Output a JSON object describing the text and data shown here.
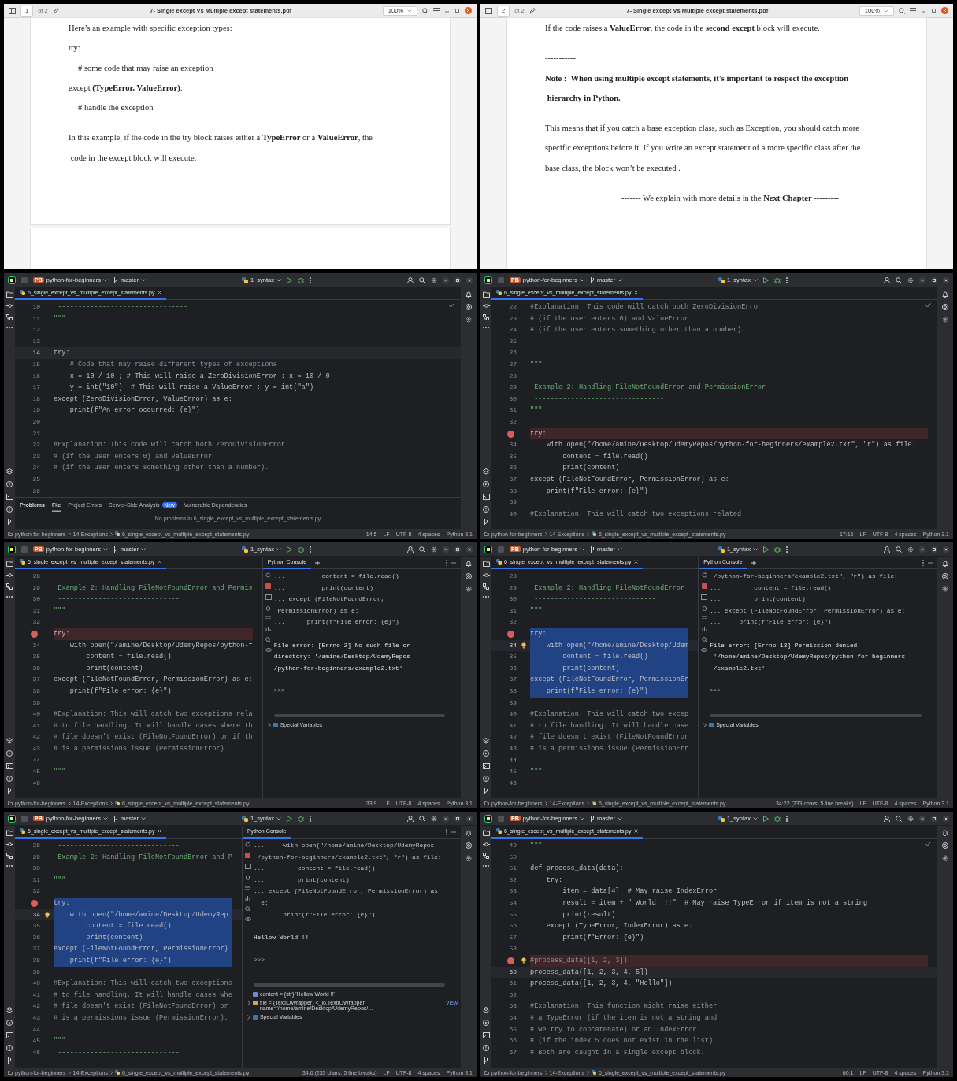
{
  "panels": [
    {
      "kind": "pdf",
      "toolbar": {
        "page": "1",
        "page_count": "of 2",
        "title": "7- Single except  Vs Multiple except statements.pdf",
        "zoom": "100%"
      },
      "next_page_visible": true,
      "blocks": [
        {
          "lines": [
            {
              "kind": "text",
              "text": "Here’s an example with specific exception types:"
            },
            {
              "kind": "text",
              "text": "try:"
            },
            {
              "kind": "code",
              "text": "# some code that may raise an exception"
            },
            {
              "kind": "text",
              "text": "except **(TypeError, ValueError)**:"
            },
            {
              "kind": "code",
              "text": "# handle the exception"
            }
          ]
        },
        {
          "lines": [
            {
              "kind": "text",
              "text": "In this example, if the code in the try block raises either a **TypeError** or a **ValueError**, the"
            },
            {
              "kind": "text",
              "text": " code in the except block will execute."
            }
          ]
        }
      ]
    },
    {
      "kind": "pdf",
      "toolbar": {
        "page": "2",
        "page_count": "of 2",
        "title": "7- Single except  Vs Multiple except statements.pdf",
        "zoom": "100%"
      },
      "next_page_visible": false,
      "blocks": [
        {
          "lines": [
            {
              "kind": "text",
              "text": "If the code raises a **ValueError**, the code in the **second except** block will execute."
            }
          ]
        },
        {
          "lines": [
            {
              "kind": "text",
              "text": "-----------"
            },
            {
              "kind": "bold",
              "text": "Note :  When using multiple except statements, it's important to respect the exception"
            },
            {
              "kind": "bold",
              "text": " hierarchy in Python."
            }
          ]
        },
        {
          "lines": [
            {
              "kind": "text",
              "text": "This means that if you catch a base exception class, such as Exception, you should catch more"
            },
            {
              "kind": "text",
              "text": "specific exceptions before it. If you write an except statement of a more specific class after the"
            },
            {
              "kind": "text",
              "text": "base class, the block won’t be executed ."
            }
          ]
        },
        {
          "lines": [
            {
              "kind": "center",
              "text": "------- We explain with more details in the **Next Chapter** ---------"
            }
          ]
        }
      ]
    },
    {
      "kind": "ide",
      "header": {
        "badge": "PB",
        "project": "python-for-beginners",
        "branch": "master",
        "run_config": "1_syntax"
      },
      "tabs": [
        {
          "label": "6_single_except_vs_multiple_except_statements.py",
          "selected": true
        }
      ],
      "inspection_ok": true,
      "lines": [
        {
          "n": "10",
          "text": " --------------------------------",
          "kind": "doc",
          "breakpoint": false,
          "selected": false,
          "current": false,
          "hint": false
        },
        {
          "n": "11",
          "text": "\"\"\"",
          "kind": "doc",
          "breakpoint": false,
          "selected": false,
          "current": false,
          "hint": false
        },
        {
          "n": "12",
          "kind": "blank",
          "breakpoint": false,
          "selected": false,
          "current": false,
          "hint": false
        },
        {
          "n": "13",
          "kind": "blank",
          "breakpoint": false,
          "selected": false,
          "current": false,
          "hint": false
        },
        {
          "n": "14",
          "text": "try:",
          "kind": "code",
          "breakpoint": false,
          "selected": false,
          "current": true,
          "hint": false
        },
        {
          "n": "15",
          "text": "    # Code that may raise different types of exceptions",
          "kind": "comment",
          "breakpoint": false,
          "selected": false,
          "current": false,
          "hint": false
        },
        {
          "n": "16",
          "text": "    x = 10 / 10 ; # This will raise a ZeroDivisionError : x = 10 / 0",
          "kind": "code",
          "breakpoint": false,
          "selected": false,
          "current": false,
          "hint": false
        },
        {
          "n": "17",
          "text": "    y = int(\"10\")  # This will raise a ValueError : y = int(\"a\")",
          "kind": "code",
          "breakpoint": false,
          "selected": false,
          "current": false,
          "hint": false
        },
        {
          "n": "18",
          "text": "except (ZeroDivisionError, ValueError) as e:",
          "kind": "code",
          "breakpoint": false,
          "selected": false,
          "current": false,
          "hint": false
        },
        {
          "n": "19",
          "text": "    print(f\"An error occurred: {e}\")",
          "kind": "code",
          "breakpoint": false,
          "selected": false,
          "current": false,
          "hint": false
        },
        {
          "n": "20",
          "kind": "blank",
          "breakpoint": false,
          "selected": false,
          "current": false,
          "hint": false
        },
        {
          "n": "21",
          "kind": "blank",
          "breakpoint": false,
          "selected": false,
          "current": false,
          "hint": false
        },
        {
          "n": "22",
          "text": "#Explanation: This code will catch both ZeroDivisionError",
          "kind": "comment",
          "breakpoint": false,
          "selected": false,
          "current": false,
          "hint": false
        },
        {
          "n": "23",
          "text": "# (if the user enters 0) and ValueError",
          "kind": "comment",
          "breakpoint": false,
          "selected": false,
          "current": false,
          "hint": false
        },
        {
          "n": "24",
          "text": "# (if the user enters something other than a number).",
          "kind": "comment",
          "breakpoint": false,
          "selected": false,
          "current": false,
          "hint": false
        },
        {
          "n": "25",
          "kind": "blank",
          "breakpoint": false,
          "selected": false,
          "current": false,
          "hint": false
        },
        {
          "n": "26",
          "kind": "blank",
          "breakpoint": false,
          "selected": false,
          "current": false,
          "hint": false
        }
      ],
      "problems": {
        "title": "Problems",
        "tabs": [
          {
            "label": "File",
            "selected": true
          },
          {
            "label": "Project Errors",
            "selected": false
          },
          {
            "label": "Server-Side Analysis",
            "badge": "New",
            "selected": false
          },
          {
            "label": "Vulnerable Dependencies",
            "selected": false
          }
        ],
        "message": "No problems in 6_single_except_vs_multiple_except_statements.py"
      },
      "status": {
        "crumbs": [
          "python-for-beginners",
          "14-Exceptions",
          "6_single_except_vs_multiple_except_statements.py"
        ],
        "position": "14:5",
        "line_separator": "LF",
        "encoding": "UTF-8",
        "indent": "4 spaces",
        "interpreter": "Python 3.1"
      }
    },
    {
      "kind": "ide",
      "header": {
        "badge": "PB",
        "project": "python-for-beginners",
        "branch": "master",
        "run_config": "1_syntax"
      },
      "tabs": [
        {
          "label": "6_single_except_vs_multiple_except_statements.py",
          "selected": true
        }
      ],
      "inspection_ok": true,
      "lines": [
        {
          "n": "22",
          "text": "#Explanation: This code will catch both ZeroDivisionError",
          "kind": "comment",
          "breakpoint": false,
          "selected": false,
          "current": false,
          "hint": false
        },
        {
          "n": "23",
          "text": "# (if the user enters 0) and ValueError",
          "kind": "comment",
          "breakpoint": false,
          "selected": false,
          "current": false,
          "hint": false
        },
        {
          "n": "24",
          "text": "# (if the user enters something other than a number).",
          "kind": "comment",
          "breakpoint": false,
          "selected": false,
          "current": false,
          "hint": false
        },
        {
          "n": "25",
          "kind": "blank",
          "breakpoint": false,
          "selected": false,
          "current": false,
          "hint": false
        },
        {
          "n": "26",
          "kind": "blank",
          "breakpoint": false,
          "selected": false,
          "current": false,
          "hint": false
        },
        {
          "n": "27",
          "text": "\"\"\"",
          "kind": "doc",
          "breakpoint": false,
          "selected": false,
          "current": false,
          "hint": false
        },
        {
          "n": "28",
          "text": " --------------------------------",
          "kind": "doc",
          "breakpoint": false,
          "selected": false,
          "current": false,
          "hint": false
        },
        {
          "n": "29",
          "text": " Example 2: Handling FileNotFoundError and PermissionError",
          "kind": "doc",
          "breakpoint": false,
          "selected": false,
          "current": false,
          "hint": false
        },
        {
          "n": "30",
          "text": " --------------------------------",
          "kind": "doc",
          "breakpoint": false,
          "selected": false,
          "current": false,
          "hint": false
        },
        {
          "n": "31",
          "text": "\"\"\"",
          "kind": "doc",
          "breakpoint": false,
          "selected": false,
          "current": false,
          "hint": false
        },
        {
          "n": "32",
          "kind": "blank",
          "breakpoint": false,
          "selected": false,
          "current": false,
          "hint": false
        },
        {
          "text": "try:",
          "kind": "code",
          "breakpoint": true,
          "selected": false,
          "current": false,
          "hint": false
        },
        {
          "n": "34",
          "text": "    with open(\"/home/amine/Desktop/UdemyRepos/python-for-beginners/example2.txt\", \"r\") as file:",
          "kind": "code",
          "breakpoint": false,
          "selected": false,
          "current": false,
          "hint": false
        },
        {
          "n": "35",
          "text": "        content = file.read()",
          "kind": "code",
          "breakpoint": false,
          "selected": false,
          "current": false,
          "hint": false
        },
        {
          "n": "36",
          "text": "        print(content)",
          "kind": "code",
          "breakpoint": false,
          "selected": false,
          "current": false,
          "hint": false
        },
        {
          "n": "37",
          "text": "except (FileNotFoundError, PermissionError) as e:",
          "kind": "code",
          "breakpoint": false,
          "selected": false,
          "current": false,
          "hint": false
        },
        {
          "n": "38",
          "text": "    print(f\"File error: {e}\")",
          "kind": "code",
          "breakpoint": false,
          "selected": false,
          "current": false,
          "hint": false
        },
        {
          "n": "39",
          "kind": "blank",
          "breakpoint": false,
          "selected": false,
          "current": false,
          "hint": false
        },
        {
          "n": "40",
          "text": "#Explanation: This will catch two exceptions related",
          "kind": "comment",
          "breakpoint": false,
          "selected": false,
          "current": false,
          "hint": false
        }
      ],
      "status": {
        "crumbs": [
          "python-for-beginners",
          "14-Exceptions",
          "6_single_except_vs_multiple_except_statements.py"
        ],
        "position": "17:16",
        "line_separator": "LF",
        "encoding": "UTF-8",
        "indent": "4 spaces",
        "interpreter": "Python 3.1"
      }
    },
    {
      "kind": "ide",
      "header": {
        "badge": "PB",
        "project": "python-for-beginners",
        "branch": "master",
        "run_config": "1_syntax"
      },
      "tabs": [
        {
          "label": "6_single_except_vs_multiple_except_statements.py",
          "selected": true
        }
      ],
      "inspection_ok": false,
      "lines": [
        {
          "n": "28",
          "text": " ------------------------------",
          "kind": "doc",
          "breakpoint": false,
          "selected": false,
          "current": false,
          "hint": false
        },
        {
          "n": "29",
          "text": " Example 2: Handling FileNotFoundError and Permis",
          "kind": "doc",
          "breakpoint": false,
          "selected": false,
          "current": false,
          "hint": false
        },
        {
          "n": "30",
          "text": " ------------------------------",
          "kind": "doc",
          "breakpoint": false,
          "selected": false,
          "current": false,
          "hint": false
        },
        {
          "n": "31",
          "text": "\"\"\"",
          "kind": "doc",
          "breakpoint": false,
          "selected": false,
          "current": false,
          "hint": false
        },
        {
          "n": "32",
          "kind": "blank",
          "breakpoint": false,
          "selected": false,
          "current": false,
          "hint": false
        },
        {
          "text": "try:",
          "kind": "code",
          "breakpoint": true,
          "selected": false,
          "current": false,
          "hint": false
        },
        {
          "n": "34",
          "text": "    with open(\"/amine/Desktop/UdemyRepos/python-f",
          "kind": "code",
          "breakpoint": false,
          "selected": false,
          "current": false,
          "hint": false
        },
        {
          "n": "35",
          "text": "        content = file.read()",
          "kind": "code",
          "breakpoint": false,
          "selected": false,
          "current": false,
          "hint": false
        },
        {
          "n": "36",
          "text": "        print(content)",
          "kind": "code",
          "breakpoint": false,
          "selected": false,
          "current": false,
          "hint": false
        },
        {
          "n": "37",
          "text": "except (FileNotFoundError, PermissionError) as e:",
          "kind": "code",
          "breakpoint": false,
          "selected": false,
          "current": false,
          "hint": false
        },
        {
          "n": "38",
          "text": "    print(f\"File error: {e}\")",
          "kind": "code",
          "breakpoint": false,
          "selected": false,
          "current": false,
          "hint": false
        },
        {
          "n": "39",
          "kind": "blank",
          "breakpoint": false,
          "selected": false,
          "current": false,
          "hint": false
        },
        {
          "n": "40",
          "text": "#Explanation: This will catch two exceptions rela",
          "kind": "comment",
          "breakpoint": false,
          "selected": false,
          "current": false,
          "hint": false
        },
        {
          "n": "41",
          "text": "# to file handling. It will handle cases where th",
          "kind": "comment",
          "breakpoint": false,
          "selected": false,
          "current": false,
          "hint": false
        },
        {
          "n": "42",
          "text": "# file doesn't exist (FileNotFoundError) or if th",
          "kind": "comment",
          "breakpoint": false,
          "selected": false,
          "current": false,
          "hint": false
        },
        {
          "n": "43",
          "text": "# is a permissions issue (PermissionError).",
          "kind": "comment",
          "breakpoint": false,
          "selected": false,
          "current": false,
          "hint": false
        },
        {
          "n": "44",
          "kind": "blank",
          "breakpoint": false,
          "selected": false,
          "current": false,
          "hint": false
        },
        {
          "n": "45",
          "text": "\"\"\"",
          "kind": "doc",
          "breakpoint": false,
          "selected": false,
          "current": false,
          "hint": false
        },
        {
          "n": "46",
          "text": " ------------------------------",
          "kind": "doc",
          "breakpoint": false,
          "selected": false,
          "current": false,
          "hint": false
        }
      ],
      "console": {
        "title": "Python Console",
        "add_button": true,
        "lines": [
          {
            "text": "...          content = file.read()",
            "kind": "input"
          },
          {
            "text": "...          print(content)",
            "kind": "input"
          },
          {
            "text": "... except (FileNotFoundError,",
            "kind": "input"
          },
          {
            "text": " PermissionError) as e:",
            "kind": "input"
          },
          {
            "text": "...      print(f\"File error: {e}\")",
            "kind": "input"
          },
          {
            "text": "...",
            "kind": "input"
          },
          {
            "text": "File error: [Errno 2] No such file or",
            "kind": "output"
          },
          {
            "text": "directory: '/amine/Desktop/UdemyRepos",
            "kind": "output"
          },
          {
            "text": "/python-for-beginners/example2.txt'",
            "kind": "output"
          },
          {
            "text": ">>>",
            "kind": "prompt"
          }
        ],
        "variables": [
          {
            "kind": "group",
            "text": "Special Variables"
          }
        ]
      },
      "status": {
        "crumbs": [
          "python-for-beginners",
          "14-Exceptions",
          "6_single_except_vs_multiple_except_statements.py"
        ],
        "position": "33:9",
        "line_separator": "LF",
        "encoding": "UTF-8",
        "indent": "4 spaces",
        "interpreter": "Python 3.1"
      }
    },
    {
      "kind": "ide",
      "header": {
        "badge": "PB",
        "project": "python-for-beginners",
        "branch": "master",
        "run_config": "1_syntax"
      },
      "tabs": [
        {
          "label": "6_single_except_vs_multiple_except_statements.py",
          "selected": true
        }
      ],
      "inspection_ok": false,
      "lines": [
        {
          "n": "28",
          "text": " ------------------------------",
          "kind": "doc",
          "breakpoint": false,
          "selected": false,
          "current": false,
          "hint": false
        },
        {
          "n": "29",
          "text": " Example 2: Handling FileNotFoundError",
          "kind": "doc",
          "breakpoint": false,
          "selected": false,
          "current": false,
          "hint": false
        },
        {
          "n": "30",
          "text": " ------------------------------",
          "kind": "doc",
          "breakpoint": false,
          "selected": false,
          "current": false,
          "hint": false
        },
        {
          "n": "31",
          "text": "\"\"\"",
          "kind": "doc",
          "breakpoint": false,
          "selected": false,
          "current": false,
          "hint": false
        },
        {
          "n": "32",
          "kind": "blank",
          "breakpoint": false,
          "selected": false,
          "current": false,
          "hint": false
        },
        {
          "text": "try:",
          "kind": "code",
          "breakpoint": true,
          "selected": true,
          "current": false,
          "hint": false
        },
        {
          "n": "34",
          "text": "    with open(\"/home/amine/Desktop/Udem",
          "kind": "code",
          "breakpoint": false,
          "selected": true,
          "current": true,
          "hint": true
        },
        {
          "n": "35",
          "text": "        content = file.read()",
          "kind": "code",
          "breakpoint": false,
          "selected": true,
          "current": false,
          "hint": false
        },
        {
          "n": "36",
          "text": "        print(content)",
          "kind": "code",
          "breakpoint": false,
          "selected": true,
          "current": false,
          "hint": false
        },
        {
          "n": "37",
          "text": "except (FileNotFoundError, PermissionEr",
          "kind": "code",
          "breakpoint": false,
          "selected": true,
          "current": false,
          "hint": false
        },
        {
          "n": "38",
          "text": "    print(f\"File error: {e}\")",
          "kind": "code",
          "breakpoint": false,
          "selected": true,
          "current": false,
          "hint": false
        },
        {
          "n": "39",
          "kind": "blank",
          "breakpoint": false,
          "selected": false,
          "current": false,
          "hint": false
        },
        {
          "n": "40",
          "text": "#Explanation: This will catch two excep",
          "kind": "comment",
          "breakpoint": false,
          "selected": false,
          "current": false,
          "hint": false
        },
        {
          "n": "41",
          "text": "# to file handling. It will handle case",
          "kind": "comment",
          "breakpoint": false,
          "selected": false,
          "current": false,
          "hint": false
        },
        {
          "n": "42",
          "text": "# file doesn't exist (FileNotFoundError",
          "kind": "comment",
          "breakpoint": false,
          "selected": false,
          "current": false,
          "hint": false
        },
        {
          "n": "43",
          "text": "# is a permissions issue (PermissionErr",
          "kind": "comment",
          "breakpoint": false,
          "selected": false,
          "current": false,
          "hint": false
        },
        {
          "n": "44",
          "kind": "blank",
          "breakpoint": false,
          "selected": false,
          "current": false,
          "hint": false
        },
        {
          "n": "45",
          "text": "\"\"\"",
          "kind": "doc",
          "breakpoint": false,
          "selected": false,
          "current": false,
          "hint": false
        },
        {
          "n": "46",
          "text": " ------------------------------",
          "kind": "doc",
          "breakpoint": false,
          "selected": false,
          "current": false,
          "hint": false
        }
      ],
      "console": {
        "title": "Python Console",
        "add_button": true,
        "lines": [
          {
            "text": " /python-for-beginners/example2.txt\", \"r\") as file:",
            "kind": "input"
          },
          {
            "text": "...         content = file.read()",
            "kind": "input"
          },
          {
            "text": "...         print(content)",
            "kind": "input"
          },
          {
            "text": "... except (FileNotFoundError, PermissionError) as e:",
            "kind": "input"
          },
          {
            "text": "...     print(f\"File error: {e}\")",
            "kind": "input"
          },
          {
            "text": "...",
            "kind": "input"
          },
          {
            "text": "File error: [Errno 13] Permission denied:",
            "kind": "output"
          },
          {
            "text": " '/home/amine/Desktop/UdemyRepos/python-for-beginners",
            "kind": "output"
          },
          {
            "text": " /example2.txt'",
            "kind": "output"
          },
          {
            "text": ">>>",
            "kind": "prompt"
          }
        ],
        "variables": [
          {
            "kind": "group",
            "text": "Special Variables"
          }
        ]
      },
      "status": {
        "crumbs": [
          "python-for-beginners",
          "14-Exceptions",
          "6_single_except_vs_multiple_except_statements.py"
        ],
        "position": "34:22 (233 chars, 5 line breaks)",
        "line_separator": "LF",
        "encoding": "UTF-8",
        "indent": "4 spaces",
        "interpreter": "Python 3.1"
      }
    },
    {
      "kind": "ide",
      "header": {
        "badge": "PB",
        "project": "python-for-beginners",
        "branch": "master",
        "run_config": "1_syntax"
      },
      "tabs": [
        {
          "label": "6_single_except_vs_multiple_except_statements.py",
          "selected": true
        }
      ],
      "inspection_ok": false,
      "lines": [
        {
          "n": "28",
          "text": " ------------------------------",
          "kind": "doc",
          "breakpoint": false,
          "selected": false,
          "current": false,
          "hint": false
        },
        {
          "n": "29",
          "text": " Example 2: Handling FileNotFoundError and P",
          "kind": "doc",
          "breakpoint": false,
          "selected": false,
          "current": false,
          "hint": false
        },
        {
          "n": "30",
          "text": " ------------------------------",
          "kind": "doc",
          "breakpoint": false,
          "selected": false,
          "current": false,
          "hint": false
        },
        {
          "n": "31",
          "text": "\"\"\"",
          "kind": "doc",
          "breakpoint": false,
          "selected": false,
          "current": false,
          "hint": false
        },
        {
          "n": "32",
          "kind": "blank",
          "breakpoint": false,
          "selected": false,
          "current": false,
          "hint": false
        },
        {
          "text": "try:",
          "kind": "code",
          "breakpoint": true,
          "selected": true,
          "current": false,
          "hint": false
        },
        {
          "n": "34",
          "text": "    with open(\"/home/amine/Desktop/UdemyRep",
          "kind": "code",
          "breakpoint": false,
          "selected": true,
          "current": true,
          "hint": true
        },
        {
          "n": "35",
          "text": "        content = file.read()",
          "kind": "code",
          "breakpoint": false,
          "selected": true,
          "current": false,
          "hint": false
        },
        {
          "n": "36",
          "text": "        print(content)",
          "kind": "code",
          "breakpoint": false,
          "selected": true,
          "current": false,
          "hint": false
        },
        {
          "n": "37",
          "text": "except (FileNotFoundError, PermissionError)",
          "kind": "code",
          "breakpoint": false,
          "selected": true,
          "current": false,
          "hint": false
        },
        {
          "n": "38",
          "text": "    print(f\"File error: {e}\")",
          "kind": "code",
          "breakpoint": false,
          "selected": true,
          "current": false,
          "hint": false
        },
        {
          "n": "39",
          "kind": "blank",
          "breakpoint": false,
          "selected": false,
          "current": false,
          "hint": false
        },
        {
          "n": "40",
          "text": "#Explanation: This will catch two exceptions",
          "kind": "comment",
          "breakpoint": false,
          "selected": false,
          "current": false,
          "hint": false
        },
        {
          "n": "41",
          "text": "# to file handling. It will handle cases whe",
          "kind": "comment",
          "breakpoint": false,
          "selected": false,
          "current": false,
          "hint": false
        },
        {
          "n": "42",
          "text": "# file doesn't exist (FileNotFoundError) or",
          "kind": "comment",
          "breakpoint": false,
          "selected": false,
          "current": false,
          "hint": false
        },
        {
          "n": "43",
          "text": "# is a permissions issue (PermissionError).",
          "kind": "comment",
          "breakpoint": false,
          "selected": false,
          "current": false,
          "hint": false
        },
        {
          "n": "44",
          "kind": "blank",
          "breakpoint": false,
          "selected": false,
          "current": false,
          "hint": false
        },
        {
          "n": "45",
          "text": "\"\"\"",
          "kind": "doc",
          "breakpoint": false,
          "selected": false,
          "current": false,
          "hint": false
        },
        {
          "n": "46",
          "text": " ------------------------------",
          "kind": "doc",
          "breakpoint": false,
          "selected": false,
          "current": false,
          "hint": false
        }
      ],
      "console": {
        "title": "Python Console",
        "add_button": false,
        "lines": [
          {
            "text": "...     with open(\"/home/amine/Desktop/UdemyRepos",
            "kind": "input"
          },
          {
            "text": " /python-for-beginners/example2.txt\", \"r\") as file:",
            "kind": "input"
          },
          {
            "text": "...         content = file.read()",
            "kind": "input"
          },
          {
            "text": "...         print(content)",
            "kind": "input"
          },
          {
            "text": "... except (FileNotFoundError, PermissionError) as",
            "kind": "input"
          },
          {
            "text": "  e:",
            "kind": "input"
          },
          {
            "text": "...     print(f\"File error: {e}\")",
            "kind": "input"
          },
          {
            "text": "...",
            "kind": "input"
          },
          {
            "text": "Hellow World !!",
            "kind": "output"
          },
          {
            "text": ">>>",
            "kind": "prompt"
          }
        ],
        "variables": [
          {
            "kind": "value",
            "text": "content = {str} 'Hellow World !!'"
          },
          {
            "kind": "object",
            "text": "file = {TextIOWrapper} <_io.TextIOWrapper name='/home/amine/Desktop/UdemyRepos/...",
            "link": "View"
          },
          {
            "kind": "group",
            "text": "Special Variables"
          }
        ]
      },
      "status": {
        "crumbs": [
          "python-for-beginners",
          "14-Exceptions",
          "6_single_except_vs_multiple_except_statements.py"
        ],
        "position": "34:6 (233 chars, 5 line breaks)",
        "line_separator": "LF",
        "encoding": "UTF-8",
        "indent": "4 spaces",
        "interpreter": "Python 3.1"
      }
    },
    {
      "kind": "ide",
      "header": {
        "badge": "PB",
        "project": "python-for-beginners",
        "branch": "master",
        "run_config": "1_syntax"
      },
      "tabs": [
        {
          "label": "6_single_except_vs_multiple_except_statements.py",
          "selected": true
        }
      ],
      "inspection_ok": true,
      "lines": [
        {
          "n": "49",
          "text": "\"\"\"",
          "kind": "doc",
          "breakpoint": false,
          "selected": false,
          "current": false,
          "hint": false
        },
        {
          "n": "50",
          "kind": "blank",
          "breakpoint": false,
          "selected": false,
          "current": false,
          "hint": false
        },
        {
          "n": "51",
          "text": "def process_data(data):",
          "kind": "code",
          "breakpoint": false,
          "selected": false,
          "current": false,
          "hint": false
        },
        {
          "n": "52",
          "text": "    try:",
          "kind": "code",
          "breakpoint": false,
          "selected": false,
          "current": false,
          "hint": false
        },
        {
          "n": "53",
          "text": "        item = data[4]  # May raise IndexError",
          "kind": "code",
          "breakpoint": false,
          "selected": false,
          "current": false,
          "hint": false
        },
        {
          "n": "54",
          "text": "        result = item + \" World !!!\"  # May raise TypeError if item is not a string",
          "kind": "code",
          "breakpoint": false,
          "selected": false,
          "current": false,
          "hint": false
        },
        {
          "n": "55",
          "text": "        print(result)",
          "kind": "code",
          "breakpoint": false,
          "selected": false,
          "current": false,
          "hint": false
        },
        {
          "n": "56",
          "text": "    except (TypeError, IndexError) as e:",
          "kind": "code",
          "breakpoint": false,
          "selected": false,
          "current": false,
          "hint": false
        },
        {
          "n": "57",
          "text": "        print(f\"Error: {e}\")",
          "kind": "code",
          "breakpoint": false,
          "selected": false,
          "current": false,
          "hint": false
        },
        {
          "n": "58",
          "kind": "blank",
          "breakpoint": false,
          "selected": false,
          "current": false,
          "hint": false
        },
        {
          "text": "#process_data([1, 2, 3])",
          "kind": "comment",
          "breakpoint": true,
          "selected": false,
          "current": false,
          "hint": true
        },
        {
          "n": "60",
          "text": "process_data([1, 2, 3, 4, 5])",
          "kind": "code",
          "breakpoint": false,
          "selected": false,
          "current": true,
          "hint": false
        },
        {
          "n": "61",
          "text": "process_data([1, 2, 3, 4, \"Hello\"])",
          "kind": "code",
          "breakpoint": false,
          "selected": false,
          "current": false,
          "hint": false
        },
        {
          "n": "62",
          "kind": "blank",
          "breakpoint": false,
          "selected": false,
          "current": false,
          "hint": false
        },
        {
          "n": "63",
          "text": "#Explanation: This function might raise either",
          "kind": "comment",
          "breakpoint": false,
          "selected": false,
          "current": false,
          "hint": false
        },
        {
          "n": "64",
          "text": "# a TypeError (if the item is not a string and",
          "kind": "comment",
          "breakpoint": false,
          "selected": false,
          "current": false,
          "hint": false
        },
        {
          "n": "65",
          "text": "# we try to concatenate) or an IndexError",
          "kind": "comment",
          "breakpoint": false,
          "selected": false,
          "current": false,
          "hint": false
        },
        {
          "n": "66",
          "text": "# (if the index 5 does not exist in the list).",
          "kind": "comment",
          "breakpoint": false,
          "selected": false,
          "current": false,
          "hint": false
        },
        {
          "n": "67",
          "text": "# Both are caught in a single except block.",
          "kind": "comment",
          "breakpoint": false,
          "selected": false,
          "current": false,
          "hint": false
        }
      ],
      "status": {
        "crumbs": [
          "python-for-beginners",
          "14-Exceptions",
          "6_single_except_vs_multiple_except_statements.py"
        ],
        "position": "60:1",
        "line_separator": "LF",
        "encoding": "UTF-8",
        "indent": "4 spaces",
        "interpreter": "Python 3.1"
      }
    }
  ]
}
